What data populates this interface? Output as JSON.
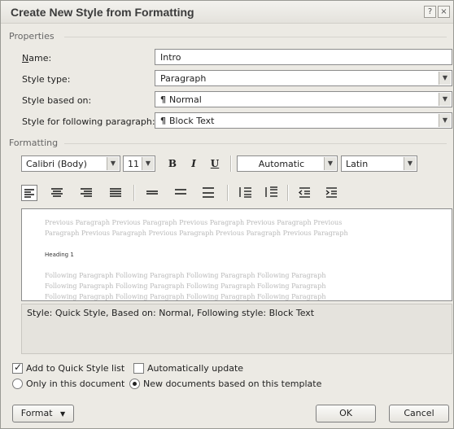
{
  "window": {
    "title": "Create New Style from Formatting",
    "help_glyph": "?",
    "close_glyph": "×"
  },
  "properties": {
    "section_label": "Properties",
    "name": {
      "label": "Name:",
      "value": "Intro"
    },
    "style_type": {
      "label": "Style type:",
      "value": "Paragraph"
    },
    "based_on": {
      "label": "Style based on:",
      "value": "Normal",
      "icon": "¶"
    },
    "following": {
      "label": "Style for following paragraph:",
      "value": "Block Text",
      "icon": "¶"
    }
  },
  "formatting": {
    "section_label": "Formatting",
    "font": "Calibri (Body)",
    "size": "11",
    "bold": "B",
    "italic": "I",
    "underline": "U",
    "color": "Automatic",
    "script": "Latin"
  },
  "preview": {
    "previous_line1": "Previous Paragraph Previous Paragraph Previous Paragraph Previous Paragraph Previous",
    "previous_line2": "Paragraph Previous Paragraph Previous Paragraph Previous Paragraph Previous Paragraph",
    "heading": "Heading 1",
    "following_line1": "Following Paragraph Following Paragraph Following Paragraph Following Paragraph",
    "following_line2": "Following Paragraph Following Paragraph Following Paragraph Following Paragraph",
    "following_line3": "Following Paragraph Following Paragraph Following Paragraph Following Paragraph"
  },
  "description": "Style: Quick Style, Based on: Normal, Following style: Block Text",
  "options": {
    "add_quick_style": "Add to Quick Style list",
    "auto_update": "Automatically update",
    "only_document": "Only in this document",
    "new_documents": "New documents based on this template"
  },
  "buttons": {
    "format": "Format",
    "ok": "OK",
    "cancel": "Cancel"
  }
}
